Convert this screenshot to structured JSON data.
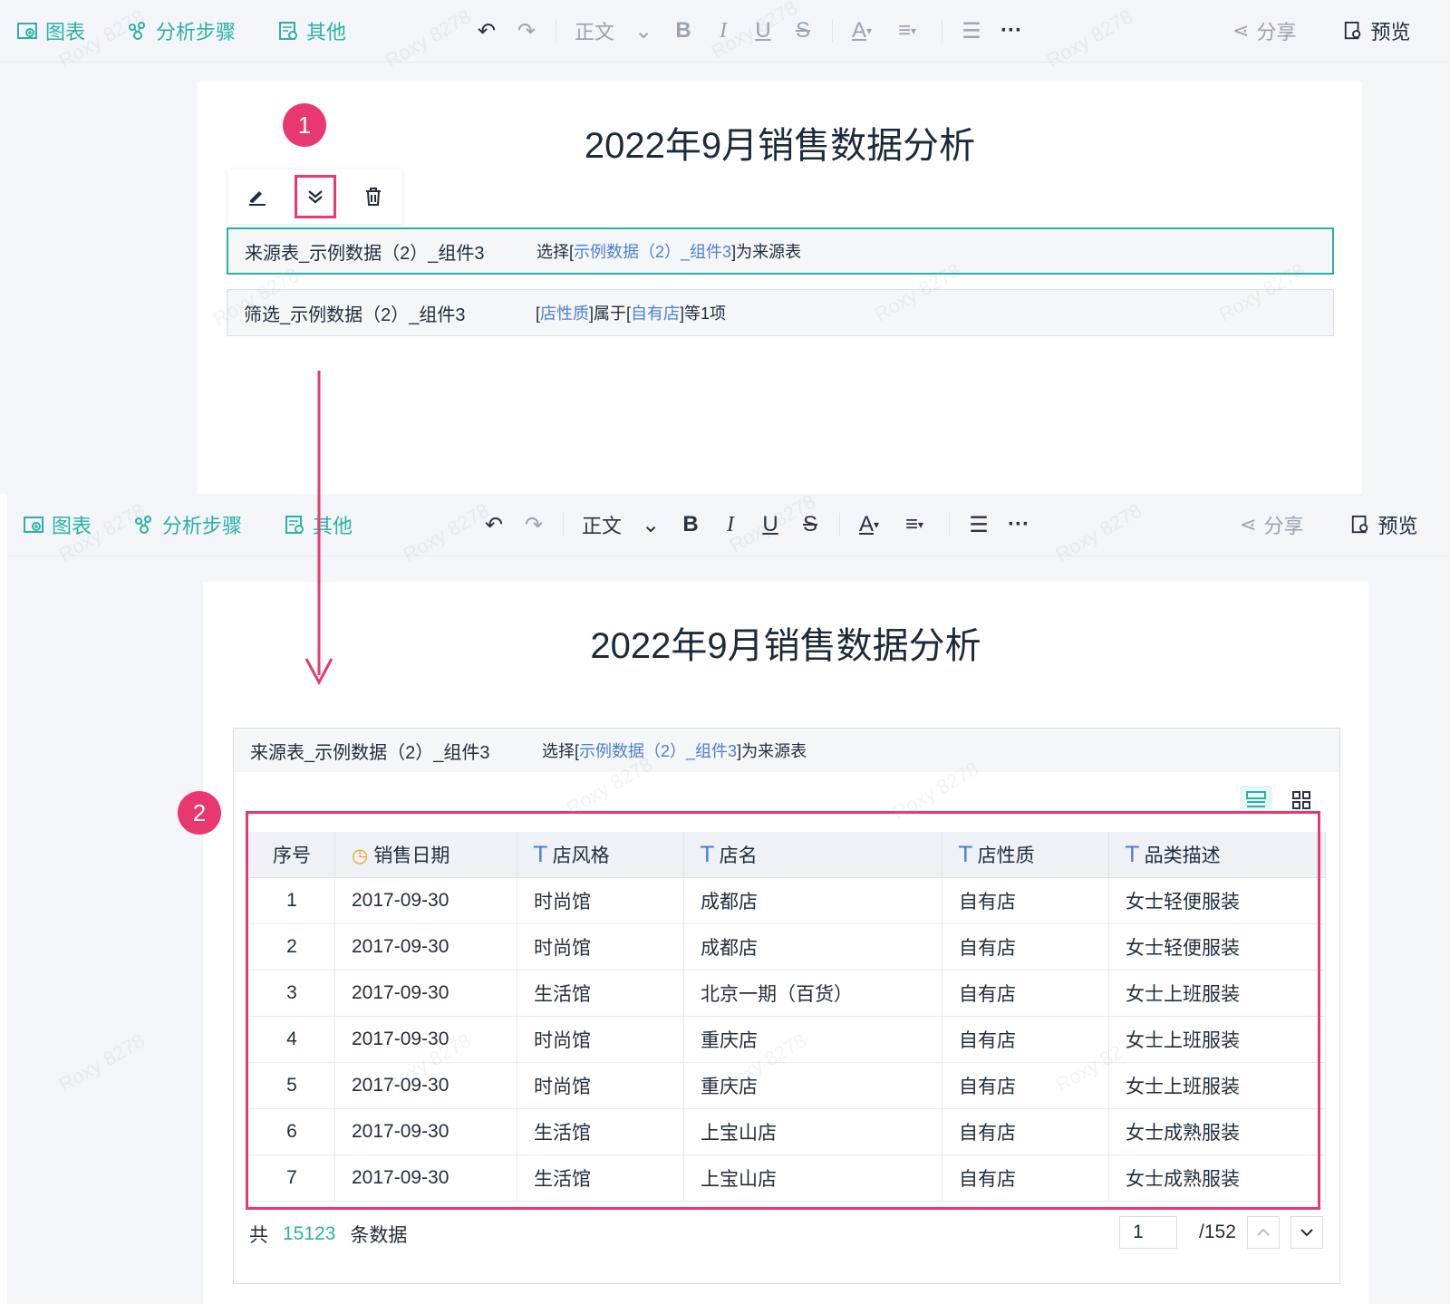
{
  "toolbar": {
    "chart_label": "图表",
    "steps_label": "分析步骤",
    "other_label": "其他",
    "text_style": "正文",
    "bold": "B",
    "italic": "I",
    "underline": "U",
    "strike": "S",
    "font_color": "A",
    "more": "···",
    "share_label": "分享",
    "preview_label": "预览"
  },
  "doc": {
    "title": "2022年9月销售数据分析"
  },
  "badges": {
    "one": "1",
    "two": "2"
  },
  "steps": [
    {
      "name": "来源表_示例数据（2）_组件3",
      "desc_prefix": "选择[",
      "desc_link": "示例数据（2）_组件3",
      "desc_suffix": "]为来源表"
    },
    {
      "name": "筛选_示例数据（2）_组件3",
      "desc_open": "[",
      "desc_field": "店性质",
      "desc_mid": "]属于[",
      "desc_value": "自有店",
      "desc_suffix": "]等1项"
    }
  ],
  "table": {
    "columns": [
      {
        "label": "序号",
        "type": ""
      },
      {
        "label": "销售日期",
        "type": "date"
      },
      {
        "label": "店风格",
        "type": "T"
      },
      {
        "label": "店名",
        "type": "T"
      },
      {
        "label": "店性质",
        "type": "T"
      },
      {
        "label": "品类描述",
        "type": "T"
      }
    ],
    "rows": [
      [
        "1",
        "2017-09-30",
        "时尚馆",
        "成都店",
        "自有店",
        "女士轻便服装"
      ],
      [
        "2",
        "2017-09-30",
        "时尚馆",
        "成都店",
        "自有店",
        "女士轻便服装"
      ],
      [
        "3",
        "2017-09-30",
        "生活馆",
        "北京一期（百货）",
        "自有店",
        "女士上班服装"
      ],
      [
        "4",
        "2017-09-30",
        "时尚馆",
        "重庆店",
        "自有店",
        "女士上班服装"
      ],
      [
        "5",
        "2017-09-30",
        "时尚馆",
        "重庆店",
        "自有店",
        "女士上班服装"
      ],
      [
        "6",
        "2017-09-30",
        "生活馆",
        "上宝山店",
        "自有店",
        "女士成熟服装"
      ],
      [
        "7",
        "2017-09-30",
        "生活馆",
        "上宝山店",
        "自有店",
        "女士成熟服装"
      ]
    ]
  },
  "footer": {
    "total_prefix": "共",
    "total_count": "15123",
    "total_suffix": "条数据",
    "page_current": "1",
    "page_total": "/152"
  },
  "watermark_text": "Roxy 8278",
  "colors": {
    "accent": "#2bb0a8",
    "highlight": "#e8386f",
    "link": "#4a7fd3"
  }
}
